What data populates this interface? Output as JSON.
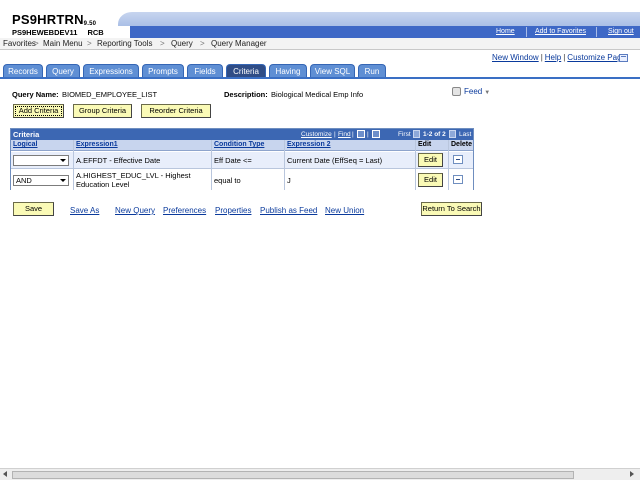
{
  "header": {
    "app_title": "PS9HRTRN",
    "version": "9.50",
    "database": "PS9HEWEBDEV11",
    "server": "RCB",
    "links": [
      "Home",
      "Add to Favorites",
      "Sign out"
    ]
  },
  "nav": {
    "items": [
      "Favorites",
      "Main Menu",
      "Reporting Tools",
      "Query",
      "Query Manager"
    ],
    "separator": ">"
  },
  "top_links": [
    "New Window",
    "Help",
    "Customize Page"
  ],
  "top_links_separator": "|",
  "tabs": [
    "Records",
    "Query",
    "Expressions",
    "Prompts",
    "Fields",
    "Criteria",
    "Having",
    "View SQL",
    "Run"
  ],
  "active_tab": "Criteria",
  "query": {
    "name_label": "Query Name:",
    "name_value": "BIOMED_EMPLOYEE_LIST",
    "desc_label": "Description:",
    "desc_value": "Biological Medical Emp Info"
  },
  "feed": {
    "label": "Feed"
  },
  "buttons": {
    "add_criteria": "Add Criteria",
    "group_criteria": "Group Criteria",
    "reorder_criteria": "Reorder Criteria",
    "save": "Save",
    "return_to_search": "Return To Search"
  },
  "grid": {
    "title": "Criteria",
    "customize": "Customize",
    "find": "Find",
    "first": "First",
    "paging": "1-2 of 2",
    "last": "Last",
    "columns": [
      "Logical",
      "Expression1",
      "Condition Type",
      "Expression 2",
      "Edit",
      "Delete"
    ],
    "edit_label": "Edit",
    "rows": [
      {
        "logical": "",
        "expression1": "A.EFFDT - Effective Date",
        "condition": "Eff Date <=",
        "expression2": "Current Date (EffSeq = Last)"
      },
      {
        "logical": "AND",
        "expression1": "A.HIGHEST_EDUC_LVL - Highest Education Level",
        "condition": "equal to",
        "expression2": "J"
      }
    ]
  },
  "bottom_links": [
    "Save As",
    "New Query",
    "Preferences",
    "Properties",
    "Publish as Feed",
    "New Union"
  ],
  "colors": {
    "tab": "#5f8fd4",
    "tab_active": "#2f4d86",
    "grid_header": "#3c67b3",
    "button": "#fafab6"
  }
}
